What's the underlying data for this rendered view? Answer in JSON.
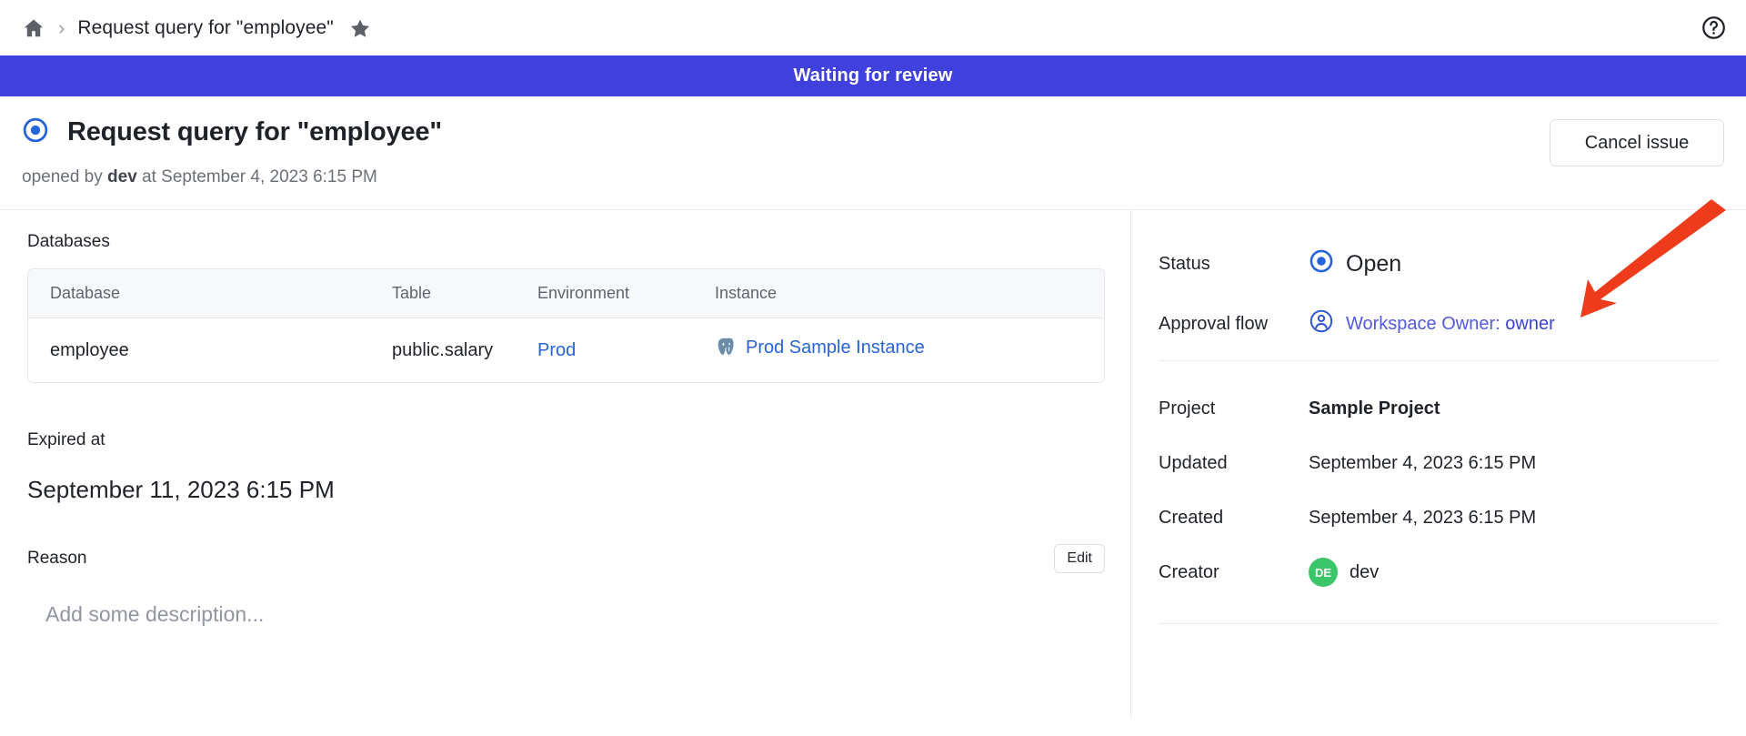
{
  "breadcrumb": {
    "home_icon": "home-icon",
    "separator": "›",
    "title": "Request query for \"employee\"",
    "star_icon": "star-icon"
  },
  "help": {
    "icon": "question-mark-circle-icon"
  },
  "banner": {
    "text": "Waiting for review",
    "color": "#4040dc"
  },
  "issue": {
    "status_icon": "open-issue-icon",
    "title": "Request query for \"employee\"",
    "subtitle_prefix": "opened by ",
    "subtitle_author": "dev",
    "subtitle_suffix": " at September 4, 2023 6:15 PM",
    "cancel_label": "Cancel issue"
  },
  "databases": {
    "section_label": "Databases",
    "columns": [
      "Database",
      "Table",
      "Environment",
      "Instance"
    ],
    "rows": [
      {
        "database": "employee",
        "table": "public.salary",
        "environment": "Prod",
        "instance": "Prod Sample Instance",
        "instance_icon": "postgres-icon"
      }
    ]
  },
  "expired": {
    "label": "Expired at",
    "value": "September 11, 2023 6:15 PM"
  },
  "reason": {
    "label": "Reason",
    "edit_label": "Edit",
    "placeholder": "Add some description..."
  },
  "sidebar": {
    "status": {
      "key": "Status",
      "value": "Open",
      "icon": "open-issue-icon",
      "color": "#2563d9"
    },
    "approval_flow": {
      "key": "Approval flow",
      "icon": "user-circle-icon",
      "role": "Workspace Owner:",
      "user": "owner",
      "color": "#3b40d8"
    },
    "project": {
      "key": "Project",
      "value": "Sample Project"
    },
    "updated": {
      "key": "Updated",
      "value": "September 4, 2023 6:15 PM"
    },
    "created": {
      "key": "Created",
      "value": "September 4, 2023 6:15 PM"
    },
    "creator": {
      "key": "Creator",
      "value": "dev",
      "avatar_initials": "DE",
      "avatar_color": "#3ac569"
    }
  },
  "annotation": {
    "arrow_icon": "red-arrow-icon",
    "color": "#ee3b1b"
  }
}
